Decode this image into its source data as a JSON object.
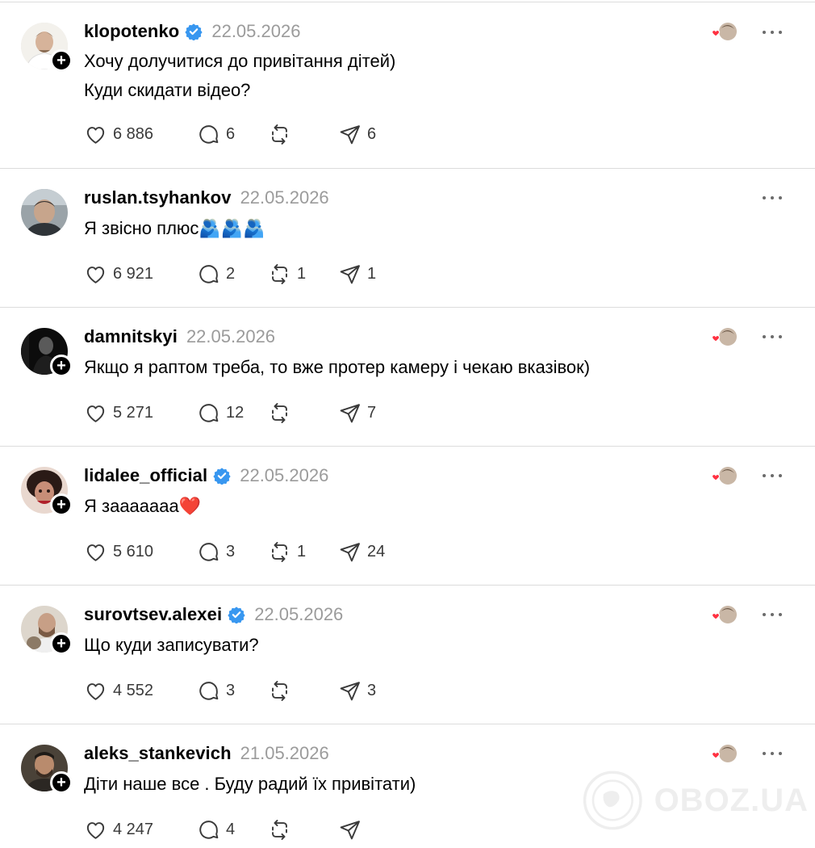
{
  "posts": [
    {
      "username": "klopotenko",
      "verified": true,
      "date": "22.05.2026",
      "text": "Хочу долучитися до привітання дітей)\nКуди скидати відео?",
      "likes": "6 886",
      "replies": "6",
      "reposts": "",
      "shares": "6",
      "liked_by_author": true,
      "has_follow_button": true
    },
    {
      "username": "ruslan.tsyhankov",
      "verified": false,
      "date": "22.05.2026",
      "text": "Я звісно плюс🫂🫂🫂",
      "likes": "6 921",
      "replies": "2",
      "reposts": "1",
      "shares": "1",
      "liked_by_author": false,
      "has_follow_button": false
    },
    {
      "username": "damnitskyi",
      "verified": false,
      "date": "22.05.2026",
      "text": "Якщо я раптом треба, то вже протер камеру і чекаю вказівок)",
      "likes": "5 271",
      "replies": "12",
      "reposts": "",
      "shares": "7",
      "liked_by_author": true,
      "has_follow_button": true
    },
    {
      "username": "lidalee_official",
      "verified": true,
      "date": "22.05.2026",
      "text": "Я зааааааа❤️",
      "likes": "5 610",
      "replies": "3",
      "reposts": "1",
      "shares": "24",
      "liked_by_author": true,
      "has_follow_button": true
    },
    {
      "username": "surovtsev.alexei",
      "verified": true,
      "date": "22.05.2026",
      "text": "Що куди записувати?",
      "likes": "4 552",
      "replies": "3",
      "reposts": "",
      "shares": "3",
      "liked_by_author": true,
      "has_follow_button": true
    },
    {
      "username": "aleks_stankevich",
      "verified": false,
      "date": "21.05.2026",
      "text": "Діти наше все . Буду радий їх привітати)",
      "likes": "4 247",
      "replies": "4",
      "reposts": "",
      "shares": "",
      "liked_by_author": true,
      "has_follow_button": true
    }
  ],
  "icons": {
    "like": "heart-icon",
    "reply": "comment-bubble-icon",
    "repost": "repost-icon",
    "share": "send-icon",
    "verified": "verified-badge-icon",
    "more": "more-options-icon",
    "follow": "plus-icon"
  },
  "colors": {
    "verified_blue": "#3897f0",
    "heart_red": "#ff3040",
    "date_gray": "#9b9b9b",
    "divider": "#dcdcdc"
  },
  "watermark": {
    "text": "OBOZ.UA"
  }
}
